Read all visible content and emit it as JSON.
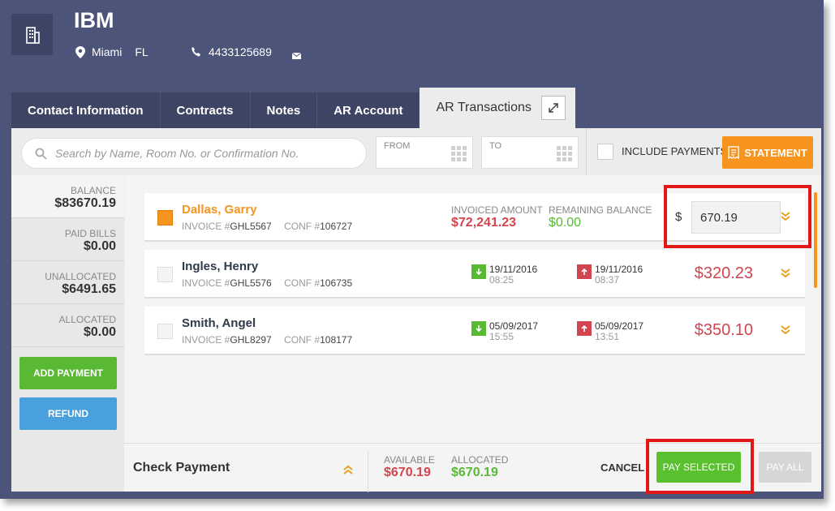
{
  "header": {
    "company": "IBM",
    "city": "Miami",
    "state": "FL",
    "phone": "4433125689"
  },
  "tabs": [
    {
      "label": "Contact Information"
    },
    {
      "label": "Contracts"
    },
    {
      "label": "Notes"
    },
    {
      "label": "AR Account"
    },
    {
      "label": "AR Transactions",
      "active": true
    }
  ],
  "toolbar": {
    "search_placeholder": "Search by Name, Room No. or Confirmation No.",
    "from_label": "FROM",
    "to_label": "TO",
    "include_payments": "INCLUDE PAYMENTS",
    "statement": "STATEMENT"
  },
  "sidebar": {
    "items": [
      {
        "label": "BALANCE",
        "value": "$83670.19"
      },
      {
        "label": "PAID BILLS",
        "value": "$0.00"
      },
      {
        "label": "UNALLOCATED",
        "value": "$6491.65"
      },
      {
        "label": "ALLOCATED",
        "value": "$0.00"
      }
    ],
    "add_payment": "ADD PAYMENT",
    "refund": "REFUND"
  },
  "rows": [
    {
      "name": "Dallas, Garry",
      "invoice_label": "INVOICE #",
      "invoice": "GHL5567",
      "conf_label": "CONF #",
      "conf": "106727",
      "checked": true,
      "invoiced_label": "INVOICED AMOUNT",
      "invoiced": "$72,241.23",
      "remaining_label": "REMAINING BALANCE",
      "remaining": "$0.00",
      "currency": "$",
      "pay_amount": "670.19"
    },
    {
      "name": "Ingles, Henry",
      "invoice_label": "INVOICE #",
      "invoice": "GHL5576",
      "conf_label": "CONF #",
      "conf": "106735",
      "in_date": "19/11/2016",
      "in_time": "08:25",
      "out_date": "19/11/2016",
      "out_time": "08:37",
      "amount": "$320.23"
    },
    {
      "name": "Smith, Angel",
      "invoice_label": "INVOICE #",
      "invoice": "GHL8297",
      "conf_label": "CONF #",
      "conf": "108177",
      "in_date": "05/09/2017",
      "in_time": "15:55",
      "out_date": "05/09/2017",
      "out_time": "13:51",
      "amount": "$350.10"
    }
  ],
  "bottom": {
    "title": "Check Payment",
    "available_label": "AVAILABLE",
    "available": "$670.19",
    "allocated_label": "ALLOCATED",
    "allocated": "$670.19",
    "cancel": "CANCEL",
    "pay_selected": "PAY SELECTED",
    "pay_all": "PAY ALL"
  },
  "colors": {
    "accent": "#f7941d",
    "green": "#59b934",
    "red": "#d2454f",
    "blue": "#4aa0dd",
    "header_bg": "#4c5479",
    "highlight": "#e01818"
  }
}
